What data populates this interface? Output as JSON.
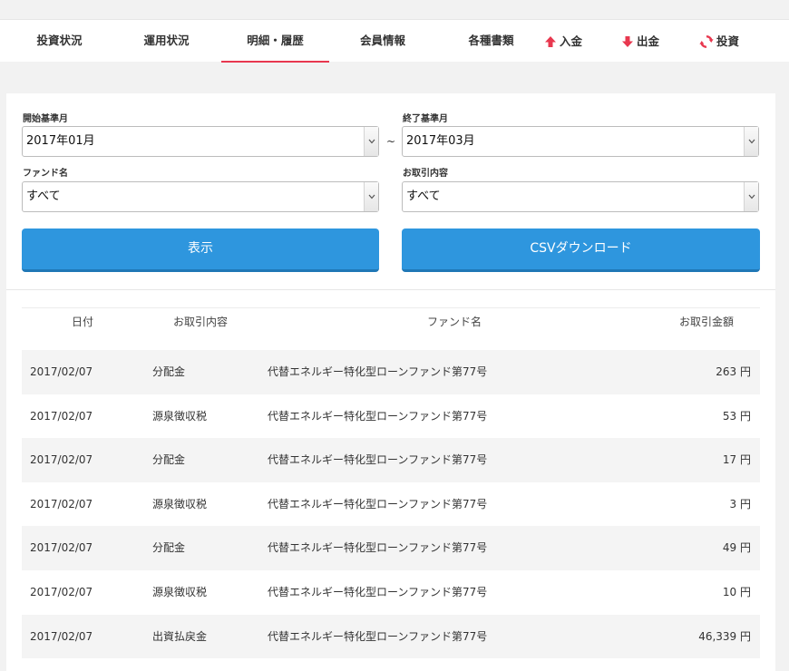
{
  "nav": {
    "tabs": [
      {
        "label": "投資状況",
        "active": false
      },
      {
        "label": "運用状況",
        "active": false
      },
      {
        "label": "明細・履歴",
        "active": true
      },
      {
        "label": "会員情報",
        "active": false
      },
      {
        "label": "各種書類",
        "active": false
      }
    ],
    "actions": [
      {
        "label": "入金",
        "icon": "arrow-up-icon"
      },
      {
        "label": "出金",
        "icon": "arrow-down-icon"
      },
      {
        "label": "投資",
        "icon": "refresh-icon"
      }
    ],
    "accent_color": "#e8384f"
  },
  "filters": {
    "start_month": {
      "label": "開始基準月",
      "value": "2017年01月"
    },
    "end_month": {
      "label": "終了基準月",
      "value": "2017年03月"
    },
    "range_separator": "~",
    "fund": {
      "label": "ファンド名",
      "value": "すべて"
    },
    "transaction_type": {
      "label": "お取引内容",
      "value": "すべて"
    }
  },
  "buttons": {
    "show": "表示",
    "csv": "CSVダウンロード",
    "color": "#2e96de"
  },
  "table": {
    "headers": {
      "date": "日付",
      "type": "お取引内容",
      "fund": "ファンド名",
      "amount": "お取引金額"
    },
    "rows": [
      {
        "date": "2017/02/07",
        "type": "分配金",
        "fund": "代替エネルギー特化型ローンファンド第77号",
        "amount": "263 円"
      },
      {
        "date": "2017/02/07",
        "type": "源泉徴収税",
        "fund": "代替エネルギー特化型ローンファンド第77号",
        "amount": "53 円"
      },
      {
        "date": "2017/02/07",
        "type": "分配金",
        "fund": "代替エネルギー特化型ローンファンド第77号",
        "amount": "17 円"
      },
      {
        "date": "2017/02/07",
        "type": "源泉徴収税",
        "fund": "代替エネルギー特化型ローンファンド第77号",
        "amount": "3 円"
      },
      {
        "date": "2017/02/07",
        "type": "分配金",
        "fund": "代替エネルギー特化型ローンファンド第77号",
        "amount": "49 円"
      },
      {
        "date": "2017/02/07",
        "type": "源泉徴収税",
        "fund": "代替エネルギー特化型ローンファンド第77号",
        "amount": "10 円"
      },
      {
        "date": "2017/02/07",
        "type": "出資払戻金",
        "fund": "代替エネルギー特化型ローンファンド第77号",
        "amount": "46,339 円"
      }
    ]
  }
}
